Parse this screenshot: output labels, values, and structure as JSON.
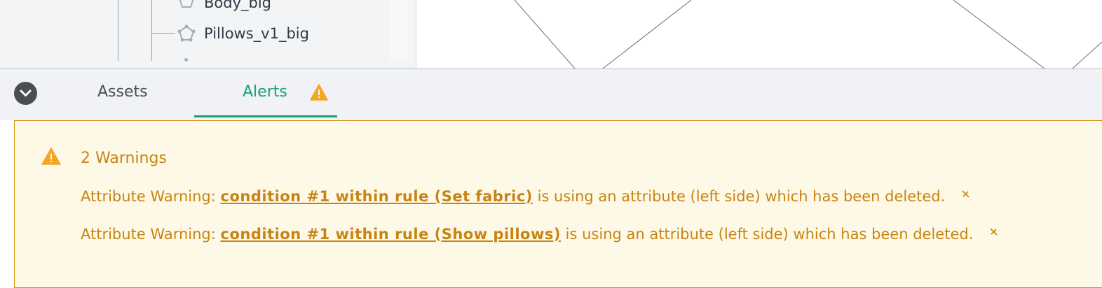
{
  "tree": {
    "items": [
      {
        "label": "Body_big"
      },
      {
        "label": "Pillows_v1_big"
      }
    ]
  },
  "tabs": [
    {
      "label": "Assets",
      "active": false
    },
    {
      "label": "Alerts",
      "active": true,
      "icon": "warning-icon"
    }
  ],
  "alerts": {
    "title": "2 Warnings",
    "icon": "warning-icon",
    "warnings": [
      {
        "prefix": "Attribute Warning:",
        "link": "condition #1 within rule (Set fabric)",
        "suffix": "is using an attribute (left side) which has been deleted."
      },
      {
        "prefix": "Attribute Warning:",
        "link": "condition #1 within rule (Show pillows)",
        "suffix": "is using an attribute (left side) which has been deleted."
      }
    ]
  },
  "colors": {
    "accent": "#1a9e78",
    "warning": "#f5a623",
    "warning_text": "#c88412",
    "alert_bg": "#fef9e6"
  }
}
